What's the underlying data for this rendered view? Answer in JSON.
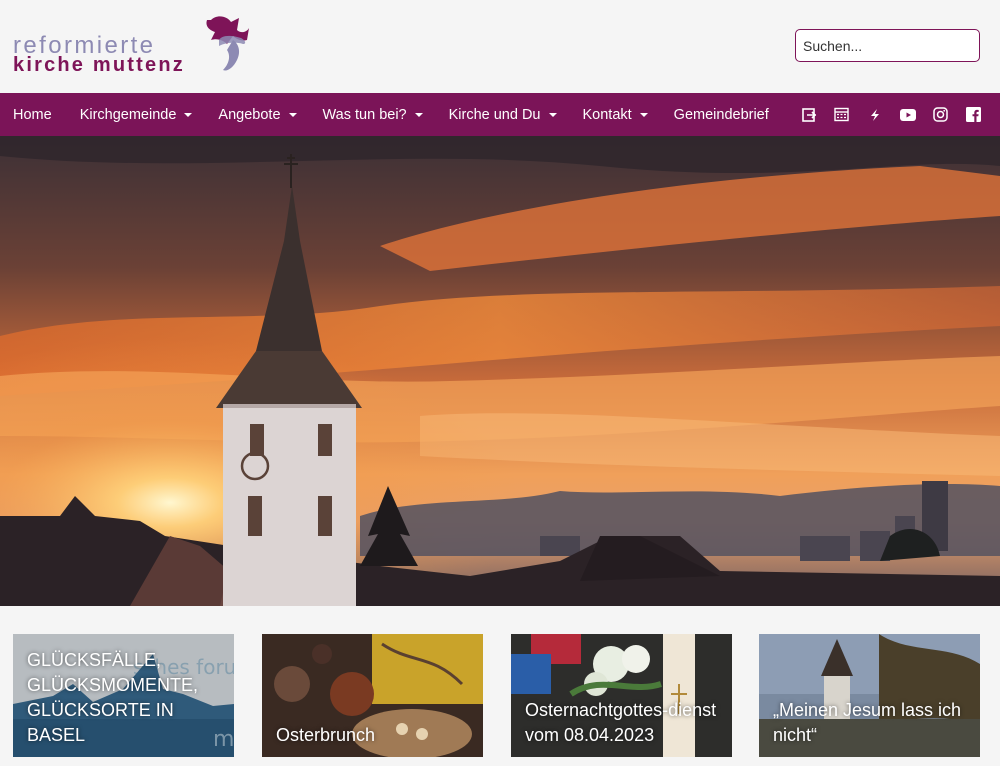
{
  "logo": {
    "line1": "reformierte",
    "line2": "kirche muttenz"
  },
  "search": {
    "placeholder": "Suchen..."
  },
  "nav": {
    "items": [
      {
        "label": "Home",
        "dropdown": false
      },
      {
        "label": "Kirchgemeinde",
        "dropdown": true
      },
      {
        "label": "Angebote",
        "dropdown": true
      },
      {
        "label": "Was tun bei?",
        "dropdown": true
      },
      {
        "label": "Kirche und Du",
        "dropdown": true
      },
      {
        "label": "Kontakt",
        "dropdown": true
      },
      {
        "label": "Gemeindebrief",
        "dropdown": false
      }
    ],
    "icons": [
      "login-icon",
      "calendar-icon",
      "bolt-icon",
      "youtube-icon",
      "instagram-icon",
      "facebook-icon"
    ]
  },
  "cards": [
    {
      "title": "GLÜCKSFÄLLE, GLÜCKSMOMENTE, GLÜCKSORTE IN BASEL"
    },
    {
      "title": "Osterbrunch"
    },
    {
      "title": "Osternachtgottes-dienst vom 08.04.2023"
    },
    {
      "title": "„Meinen Jesum lass ich nicht“"
    }
  ],
  "colors": {
    "brand": "#7b1458",
    "logo_light": "#8d8ab3"
  }
}
